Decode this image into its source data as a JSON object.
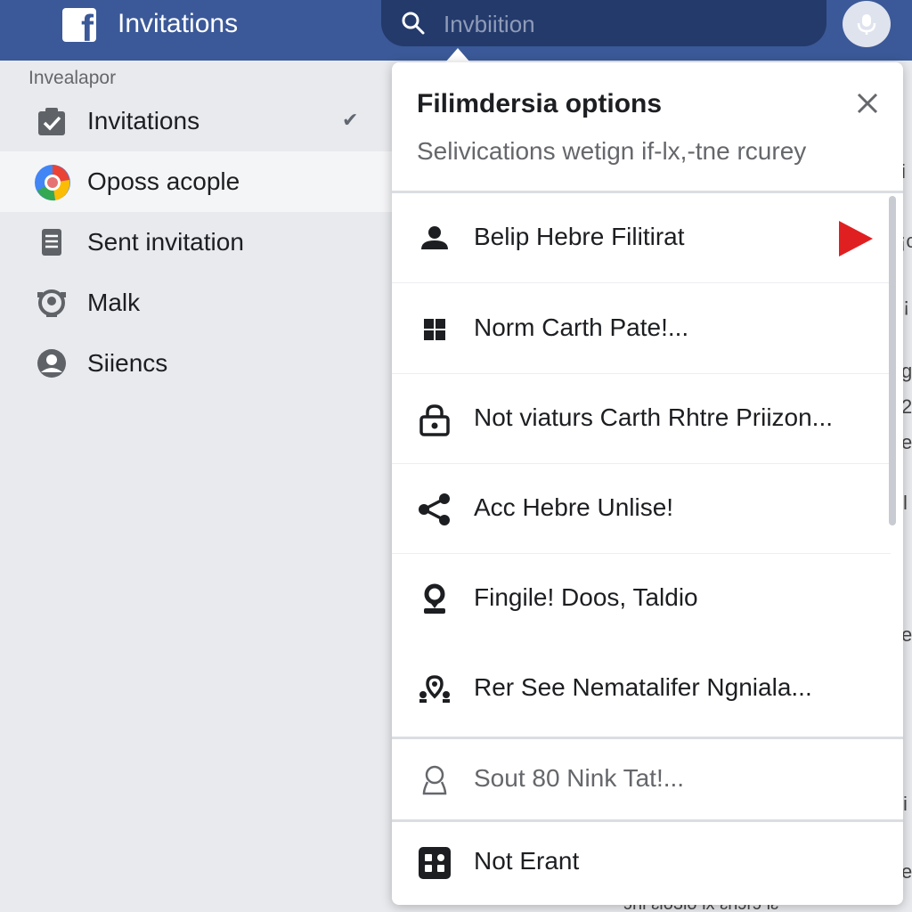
{
  "header": {
    "app_title": "Invitations",
    "search": {
      "value": "Invbiition"
    }
  },
  "sidebar": {
    "header": "Invealapor",
    "items": [
      {
        "label": "Invitations",
        "icon": "clipboard-check-icon",
        "checked": true
      },
      {
        "label": "Oposs acople",
        "icon": "chrome-color-icon",
        "active": true
      },
      {
        "label": "Sent invitation",
        "icon": "document-icon"
      },
      {
        "label": "Malk",
        "icon": "camera-icon"
      },
      {
        "label": "Siiencs",
        "icon": "user-circle-icon"
      }
    ],
    "check_glyph": "✔"
  },
  "popup": {
    "title": "Filimdersia options",
    "subtitle": "Selivications wetign if-lx,-tne rcurey",
    "options": [
      {
        "label": "Belip Hebre Filitirat",
        "icon": "person-icon"
      },
      {
        "label": "Norm Carth Pate!...",
        "icon": "windows-icon"
      },
      {
        "label": "Not viaturs Carth Rhtre Priizon...",
        "icon": "lock-icon"
      },
      {
        "label": "Acc Hebre Unlise!",
        "icon": "share-icon"
      },
      {
        "label": "Fingile! Doos, Taldio",
        "icon": "person-pin-icon"
      },
      {
        "label": "Rer See Nematalifer Ngniala...",
        "icon": "people-pin-icon"
      },
      {
        "label": "Sout 80 Nink Tat!...",
        "icon": "user-outline-icon",
        "muted": true
      },
      {
        "label": "Not Erant",
        "icon": "grid-app-icon"
      }
    ]
  },
  "background": {
    "fragments": [
      "i",
      "¡c",
      "¡",
      "g",
      "2",
      "e",
      "l",
      "e",
      "i",
      "e"
    ],
    "bottom_text": "ɔni ɛlo3lo lx  ɛnɔrɔ lɛ"
  },
  "colors": {
    "topbar": "#3b5998",
    "search_bg": "#233a6b",
    "play_red": "#e02020"
  }
}
